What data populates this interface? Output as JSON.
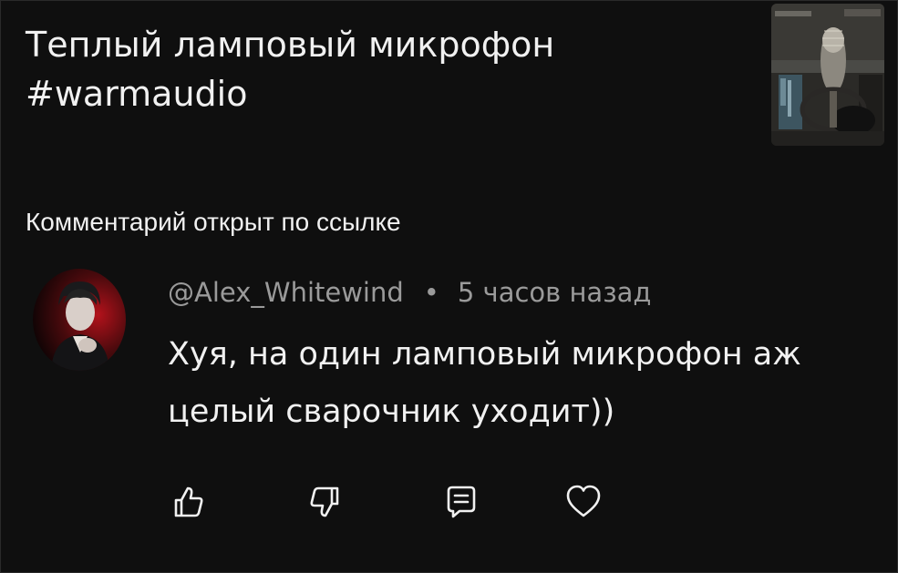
{
  "video": {
    "title_line1": "Теплый ламповый микрофон",
    "title_line2": "#warmaudio"
  },
  "section": {
    "label": "Комментарий открыт по ссылке"
  },
  "comment": {
    "author": "@Alex_Whitewind",
    "separator": "•",
    "time": "5 часов назад",
    "text": "Хуя, на один ламповый микрофон аж целый сварочник уходит))"
  },
  "actions": {
    "icons": [
      "thumbs-up-icon",
      "thumbs-down-icon",
      "reply-icon",
      "heart-icon"
    ]
  },
  "colors": {
    "background": "#0f0f0f",
    "text": "#f1f1f1",
    "meta": "#9a9a9a",
    "accent_red": "#b3121b"
  }
}
